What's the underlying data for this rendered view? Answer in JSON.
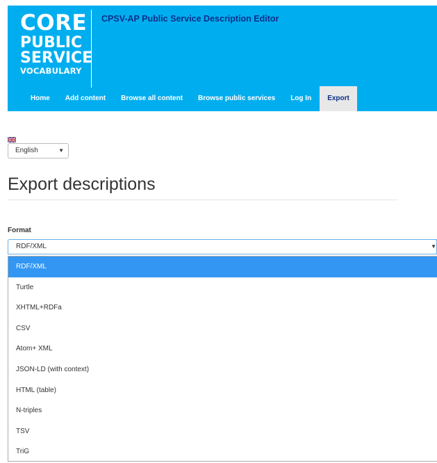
{
  "header": {
    "logo_lines": [
      "CORE",
      "PUBLIC",
      "SERVICE",
      "VOCABULARY"
    ],
    "site_title": "CPSV-AP Public Service Description Editor",
    "bg_color": "#00aeef"
  },
  "nav": {
    "items": [
      "Home",
      "Add content",
      "Browse all content",
      "Browse public services",
      "Log In",
      "Export"
    ],
    "active": "Export"
  },
  "language": {
    "flag_icon": "uk-flag-icon",
    "selected": "English"
  },
  "page": {
    "title": "Export descriptions"
  },
  "format": {
    "label": "Format",
    "selected": "RDF/XML",
    "options": [
      "RDF/XML",
      "Turtle",
      "XHTML+RDFa",
      "CSV",
      "Atom+ XML",
      "JSON-LD (with context)",
      "HTML (table)",
      "N-triples",
      "TSV",
      "TriG"
    ],
    "highlight_color": "#3296f2"
  }
}
